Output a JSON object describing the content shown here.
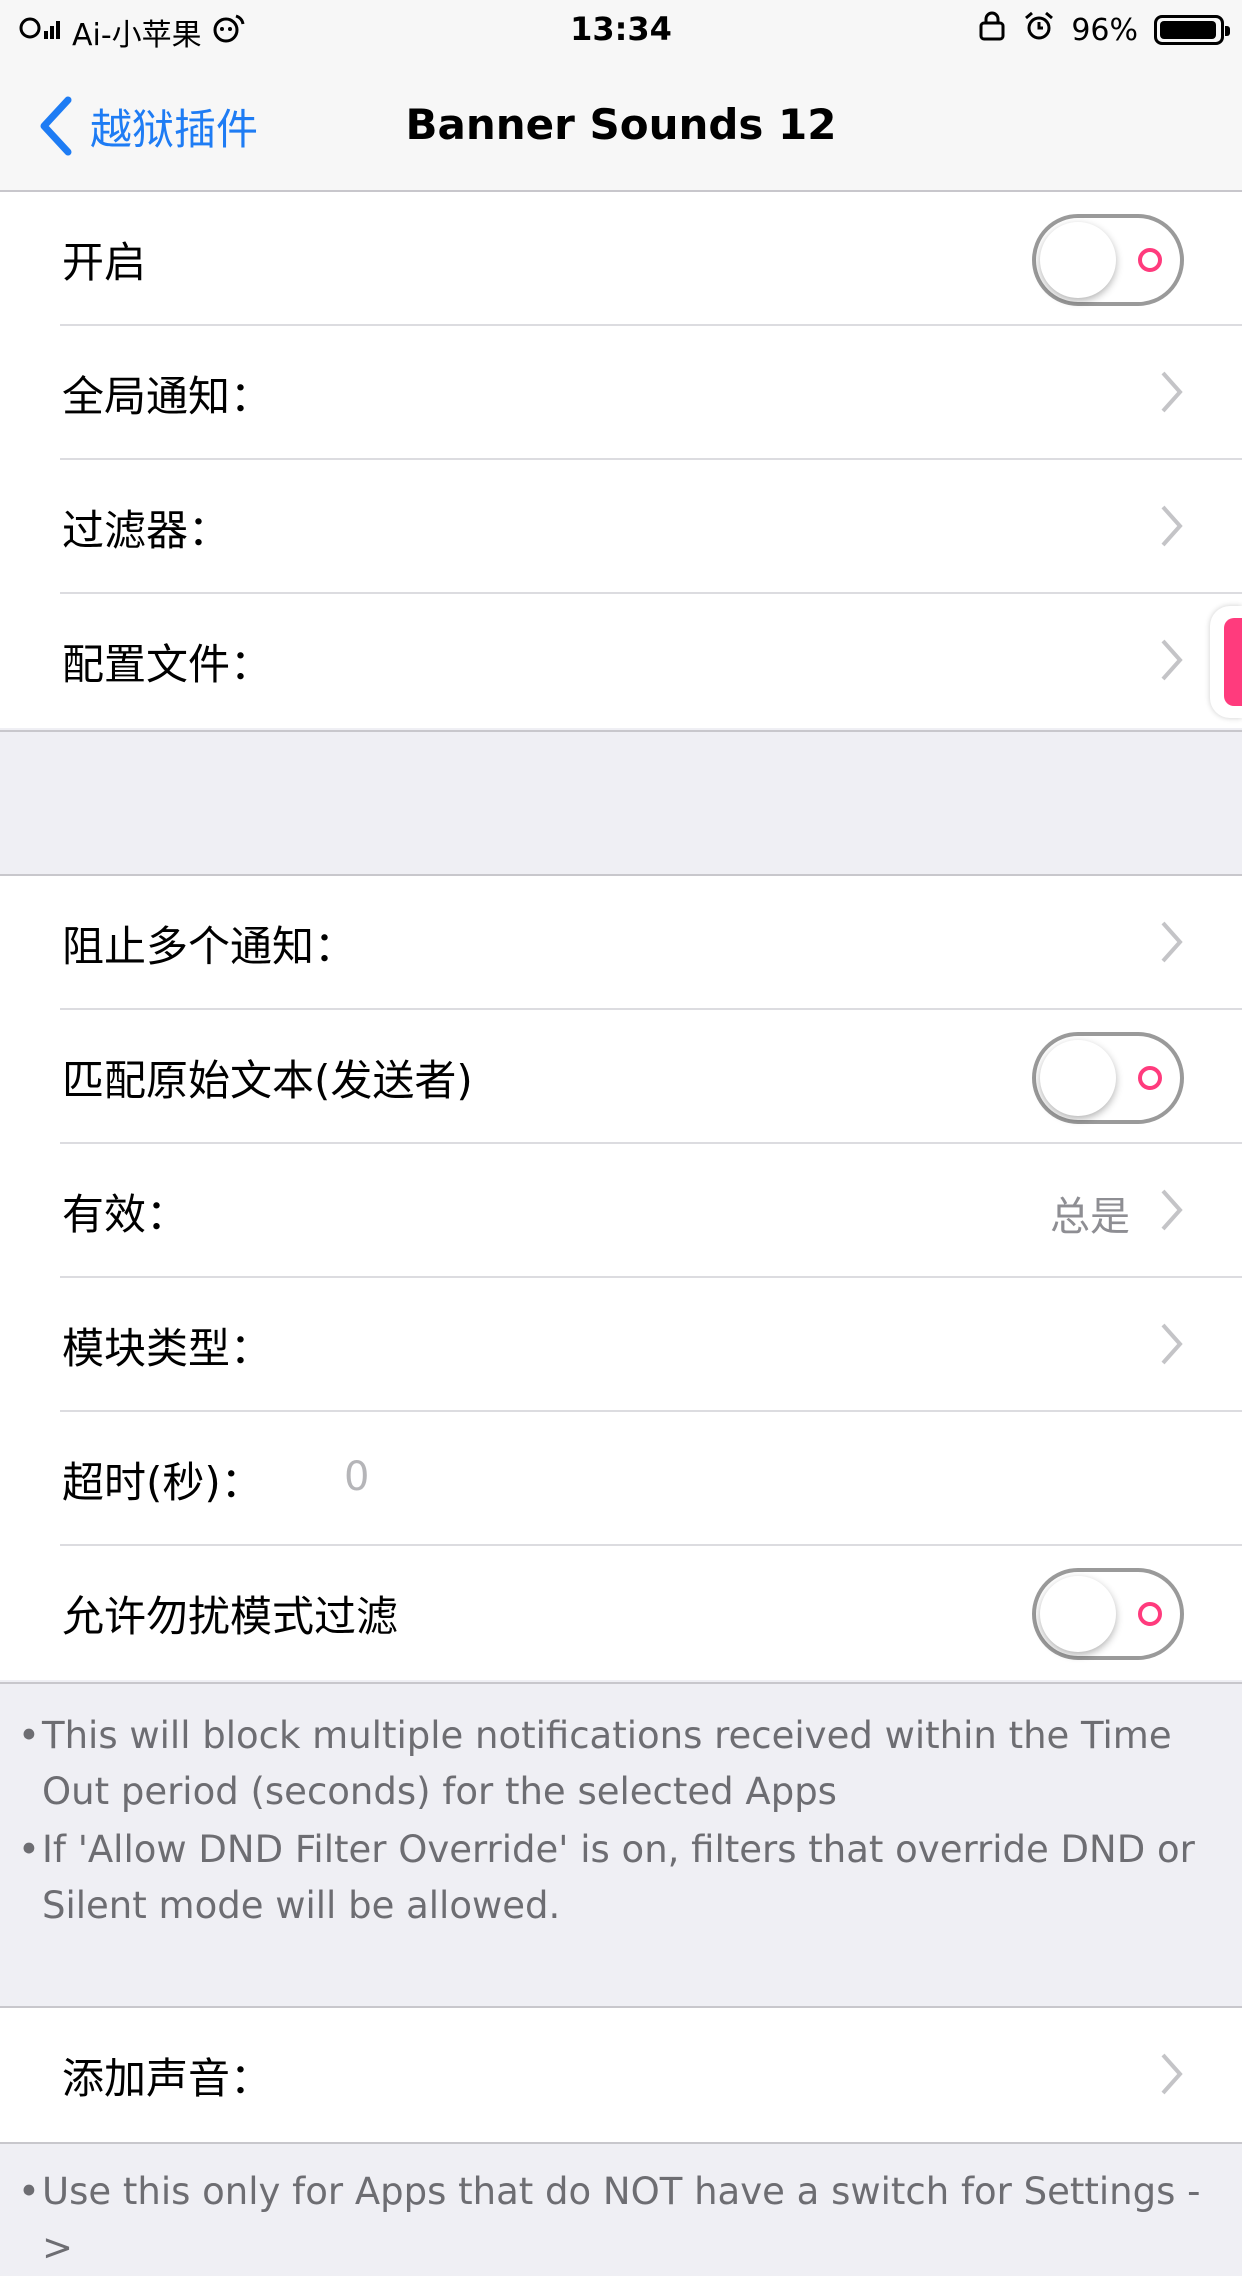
{
  "status": {
    "carrier": "Ai-小苹果",
    "time": "13:34",
    "battery": "96%",
    "battery_level": 0.96
  },
  "nav": {
    "back_label": "越狱插件",
    "title": "Banner Sounds 12"
  },
  "group1": {
    "enable_label": "开启",
    "global_notify_label": "全局通知：",
    "filter_label": "过滤器：",
    "profile_label": "配置文件："
  },
  "group2": {
    "block_multiple_label": "阻止多个通知：",
    "match_text_label": "匹配原始文本(发送者)",
    "active_label": "有效：",
    "active_value": "总是",
    "module_type_label": "模块类型：",
    "timeout_label": "超时(秒)：",
    "timeout_placeholder": "0",
    "allow_dnd_label": "允许勿扰模式过滤"
  },
  "footnote1": {
    "line1": "This will block multiple notifications received within the Time Out period (seconds) for the selected Apps",
    "line2": "If 'Allow DND Filter Override' is on, filters that override DND or Silent mode will be allowed."
  },
  "group3": {
    "add_sound_label": "添加声音："
  },
  "footnote2": {
    "line1": "Use this only for Apps that do NOT have a switch for Settings ->"
  },
  "toggles": {
    "enable_on": false,
    "match_text_on": false,
    "allow_dnd_on": false
  }
}
